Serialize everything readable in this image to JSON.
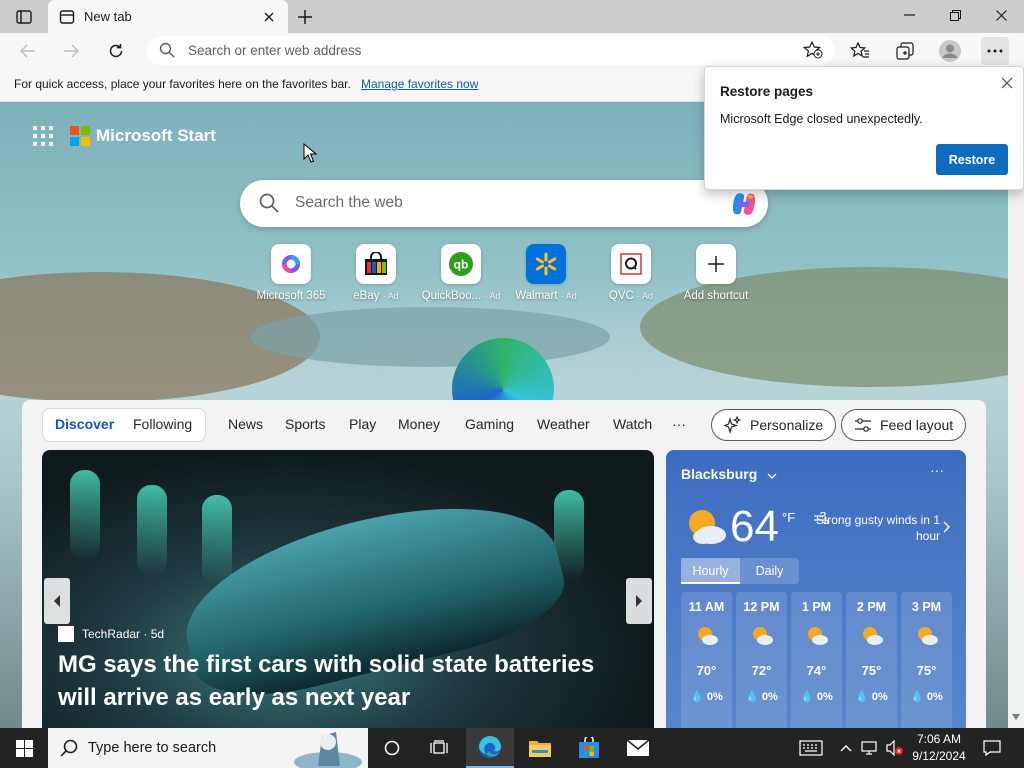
{
  "browser": {
    "tab": {
      "title": "New tab"
    },
    "address_placeholder": "Search or enter web address"
  },
  "favorites_bar": {
    "message": "For quick access, place your favorites here on the favorites bar.",
    "link": "Manage favorites now"
  },
  "newtab": {
    "brand": "Microsoft Start",
    "search_placeholder": "Search the web",
    "shortcuts": [
      {
        "label": "Microsoft 365",
        "ad": "",
        "icon": "microsoft365-icon"
      },
      {
        "label": "eBay",
        "ad": "· Ad",
        "icon": "ebay-icon"
      },
      {
        "label": "QuickBoo...",
        "ad": "· Ad",
        "icon": "quickbooks-icon"
      },
      {
        "label": "Walmart",
        "ad": "· Ad",
        "icon": "walmart-icon"
      },
      {
        "label": "QVC",
        "ad": "· Ad",
        "icon": "qvc-icon"
      },
      {
        "label": "Add shortcut",
        "ad": "",
        "icon": "plus-icon"
      }
    ]
  },
  "feed": {
    "tabs": [
      "Discover",
      "Following",
      "News",
      "Sports",
      "Play",
      "Money",
      "Gaming",
      "Weather",
      "Watch"
    ],
    "active_tab": "Discover",
    "more": "···",
    "personalize": "Personalize",
    "feed_layout": "Feed layout",
    "hero": {
      "source": "TechRadar · 5d",
      "headline": "MG says the first cars with solid state batteries will arrive as early as next year"
    },
    "weather": {
      "city": "Blacksburg",
      "more": "···",
      "temp": "64",
      "unit": "°F",
      "alert": "Strong gusty winds in 1 hour",
      "tabs": [
        "Hourly",
        "Daily"
      ],
      "hours": [
        {
          "time": "11 AM",
          "temp": "70°",
          "precip": "0%"
        },
        {
          "time": "12 PM",
          "temp": "72°",
          "precip": "0%"
        },
        {
          "time": "1 PM",
          "temp": "74°",
          "precip": "0%"
        },
        {
          "time": "2 PM",
          "temp": "75°",
          "precip": "0%"
        },
        {
          "time": "3 PM",
          "temp": "75°",
          "precip": "0%"
        }
      ]
    }
  },
  "restore_popup": {
    "title": "Restore pages",
    "message": "Microsoft Edge closed unexpectedly.",
    "button": "Restore"
  },
  "taskbar": {
    "search_placeholder": "Type here to search",
    "time": "7:06 AM",
    "date": "9/12/2024"
  },
  "colors": {
    "accent": "#0f6cbd",
    "link": "#0e57c2",
    "weather_bg": "#4a78c6",
    "taskbar": "#232323"
  }
}
